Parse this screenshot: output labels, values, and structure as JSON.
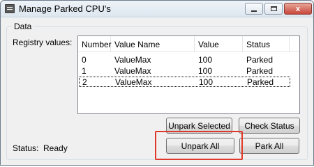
{
  "window": {
    "title": "Manage Parked CPU's",
    "close_glyph": "x"
  },
  "group": {
    "legend": "Data",
    "registry_label": "Registry values:"
  },
  "listview": {
    "columns": [
      "Number",
      "Value Name",
      "Value",
      "Status"
    ],
    "rows": [
      [
        "0",
        "ValueMax",
        "100",
        "Parked"
      ],
      [
        "1",
        "ValueMax",
        "100",
        "Parked"
      ],
      [
        "2",
        "ValueMax",
        "100",
        "Parked"
      ]
    ]
  },
  "buttons": {
    "unpark_selected": "Unpark Selected",
    "check_status": "Check Status",
    "unpark_all": "Unpark All",
    "park_all": "Park All"
  },
  "status": {
    "label": "Status:",
    "value": "Ready"
  },
  "colors": {
    "highlight": "#e0392b"
  }
}
